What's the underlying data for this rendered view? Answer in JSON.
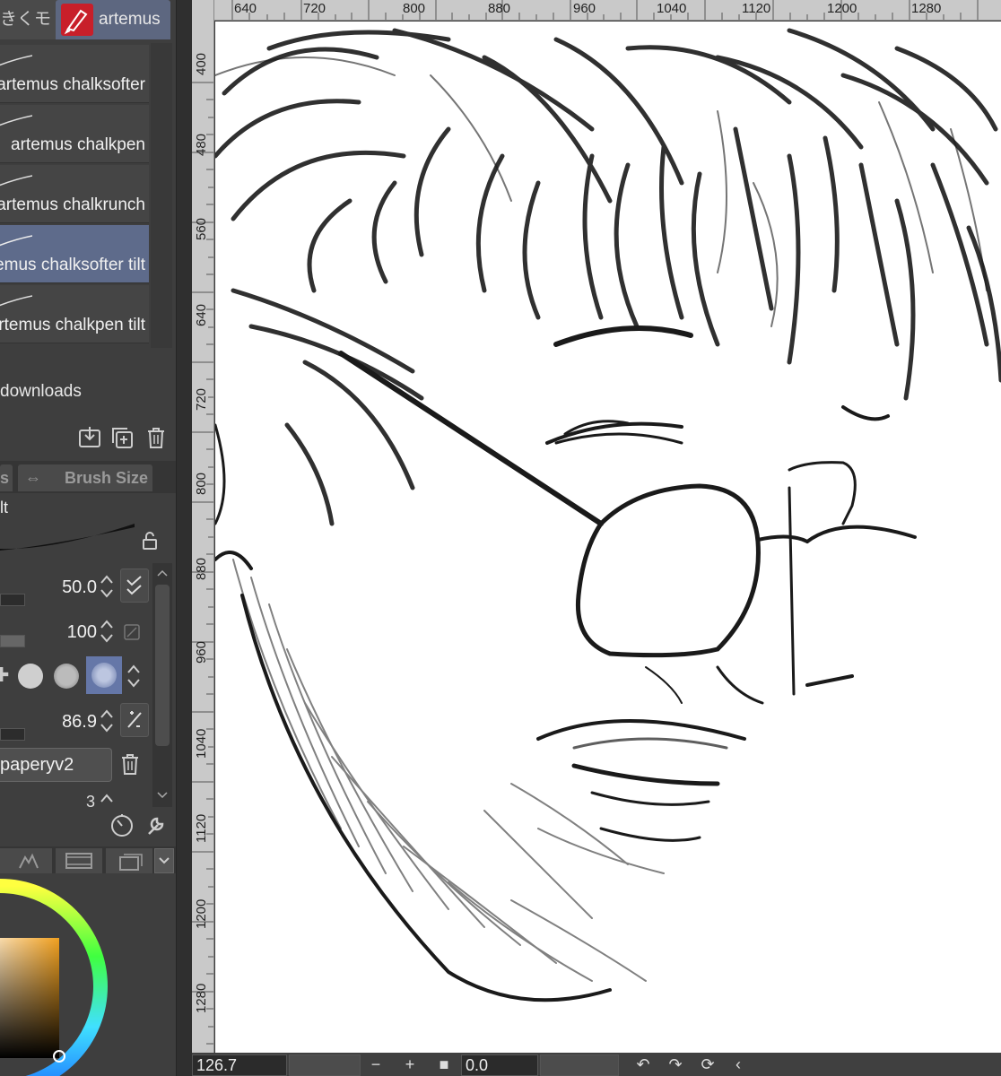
{
  "tabs": [
    {
      "label": "きくモフ"
    },
    {
      "label": "artemus"
    }
  ],
  "brushes": [
    {
      "label": "artemus chalksofter",
      "selected": false
    },
    {
      "label": "artemus chalkpen",
      "selected": false
    },
    {
      "label": "artemus chalkrunch",
      "selected": false
    },
    {
      "label": "artemus chalksofter tilt",
      "selected": true
    },
    {
      "label": "artemus chalkpen tilt",
      "selected": false
    }
  ],
  "downloads_label": "downloads",
  "subtabs": [
    {
      "label": "s"
    },
    {
      "label": "Brush Size"
    }
  ],
  "brush_settings": {
    "name": "lt",
    "properties": [
      {
        "value": "50.0"
      },
      {
        "value": "100"
      },
      {
        "value": ""
      },
      {
        "value": "86.9"
      }
    ],
    "texture": "paperyv2",
    "partial_value": "3"
  },
  "ruler": {
    "top": [
      "640",
      "720",
      "800",
      "880",
      "960",
      "1040",
      "1120",
      "1200",
      "1280"
    ],
    "left": [
      "400",
      "480",
      "560",
      "640",
      "720",
      "800",
      "880",
      "960",
      "1040",
      "1120",
      "1200",
      "1280"
    ]
  },
  "status": {
    "zoom": "126.7",
    "rotation": "0.0"
  },
  "colors": {
    "panel_bg": "#3e3e3e",
    "selected_row": "#5e6b8b",
    "active_tab": "#5d6780",
    "app_icon": "#c81f2a",
    "ruler_bg": "#c9c9c9",
    "canvas_bg": "#ffffff",
    "ink": "#1a1a1a",
    "color_square_orange": "#f0a020"
  },
  "icons": [
    "pen-nib-icon",
    "download-icon",
    "duplicate-icon",
    "trash-icon",
    "lock-icon",
    "chain-icon",
    "brush-dots-icon",
    "pressure-icon",
    "clock-icon",
    "wrench-icon",
    "color-wheel-icon",
    "undo-icon",
    "redo-icon",
    "reset-rotation-icon"
  ]
}
